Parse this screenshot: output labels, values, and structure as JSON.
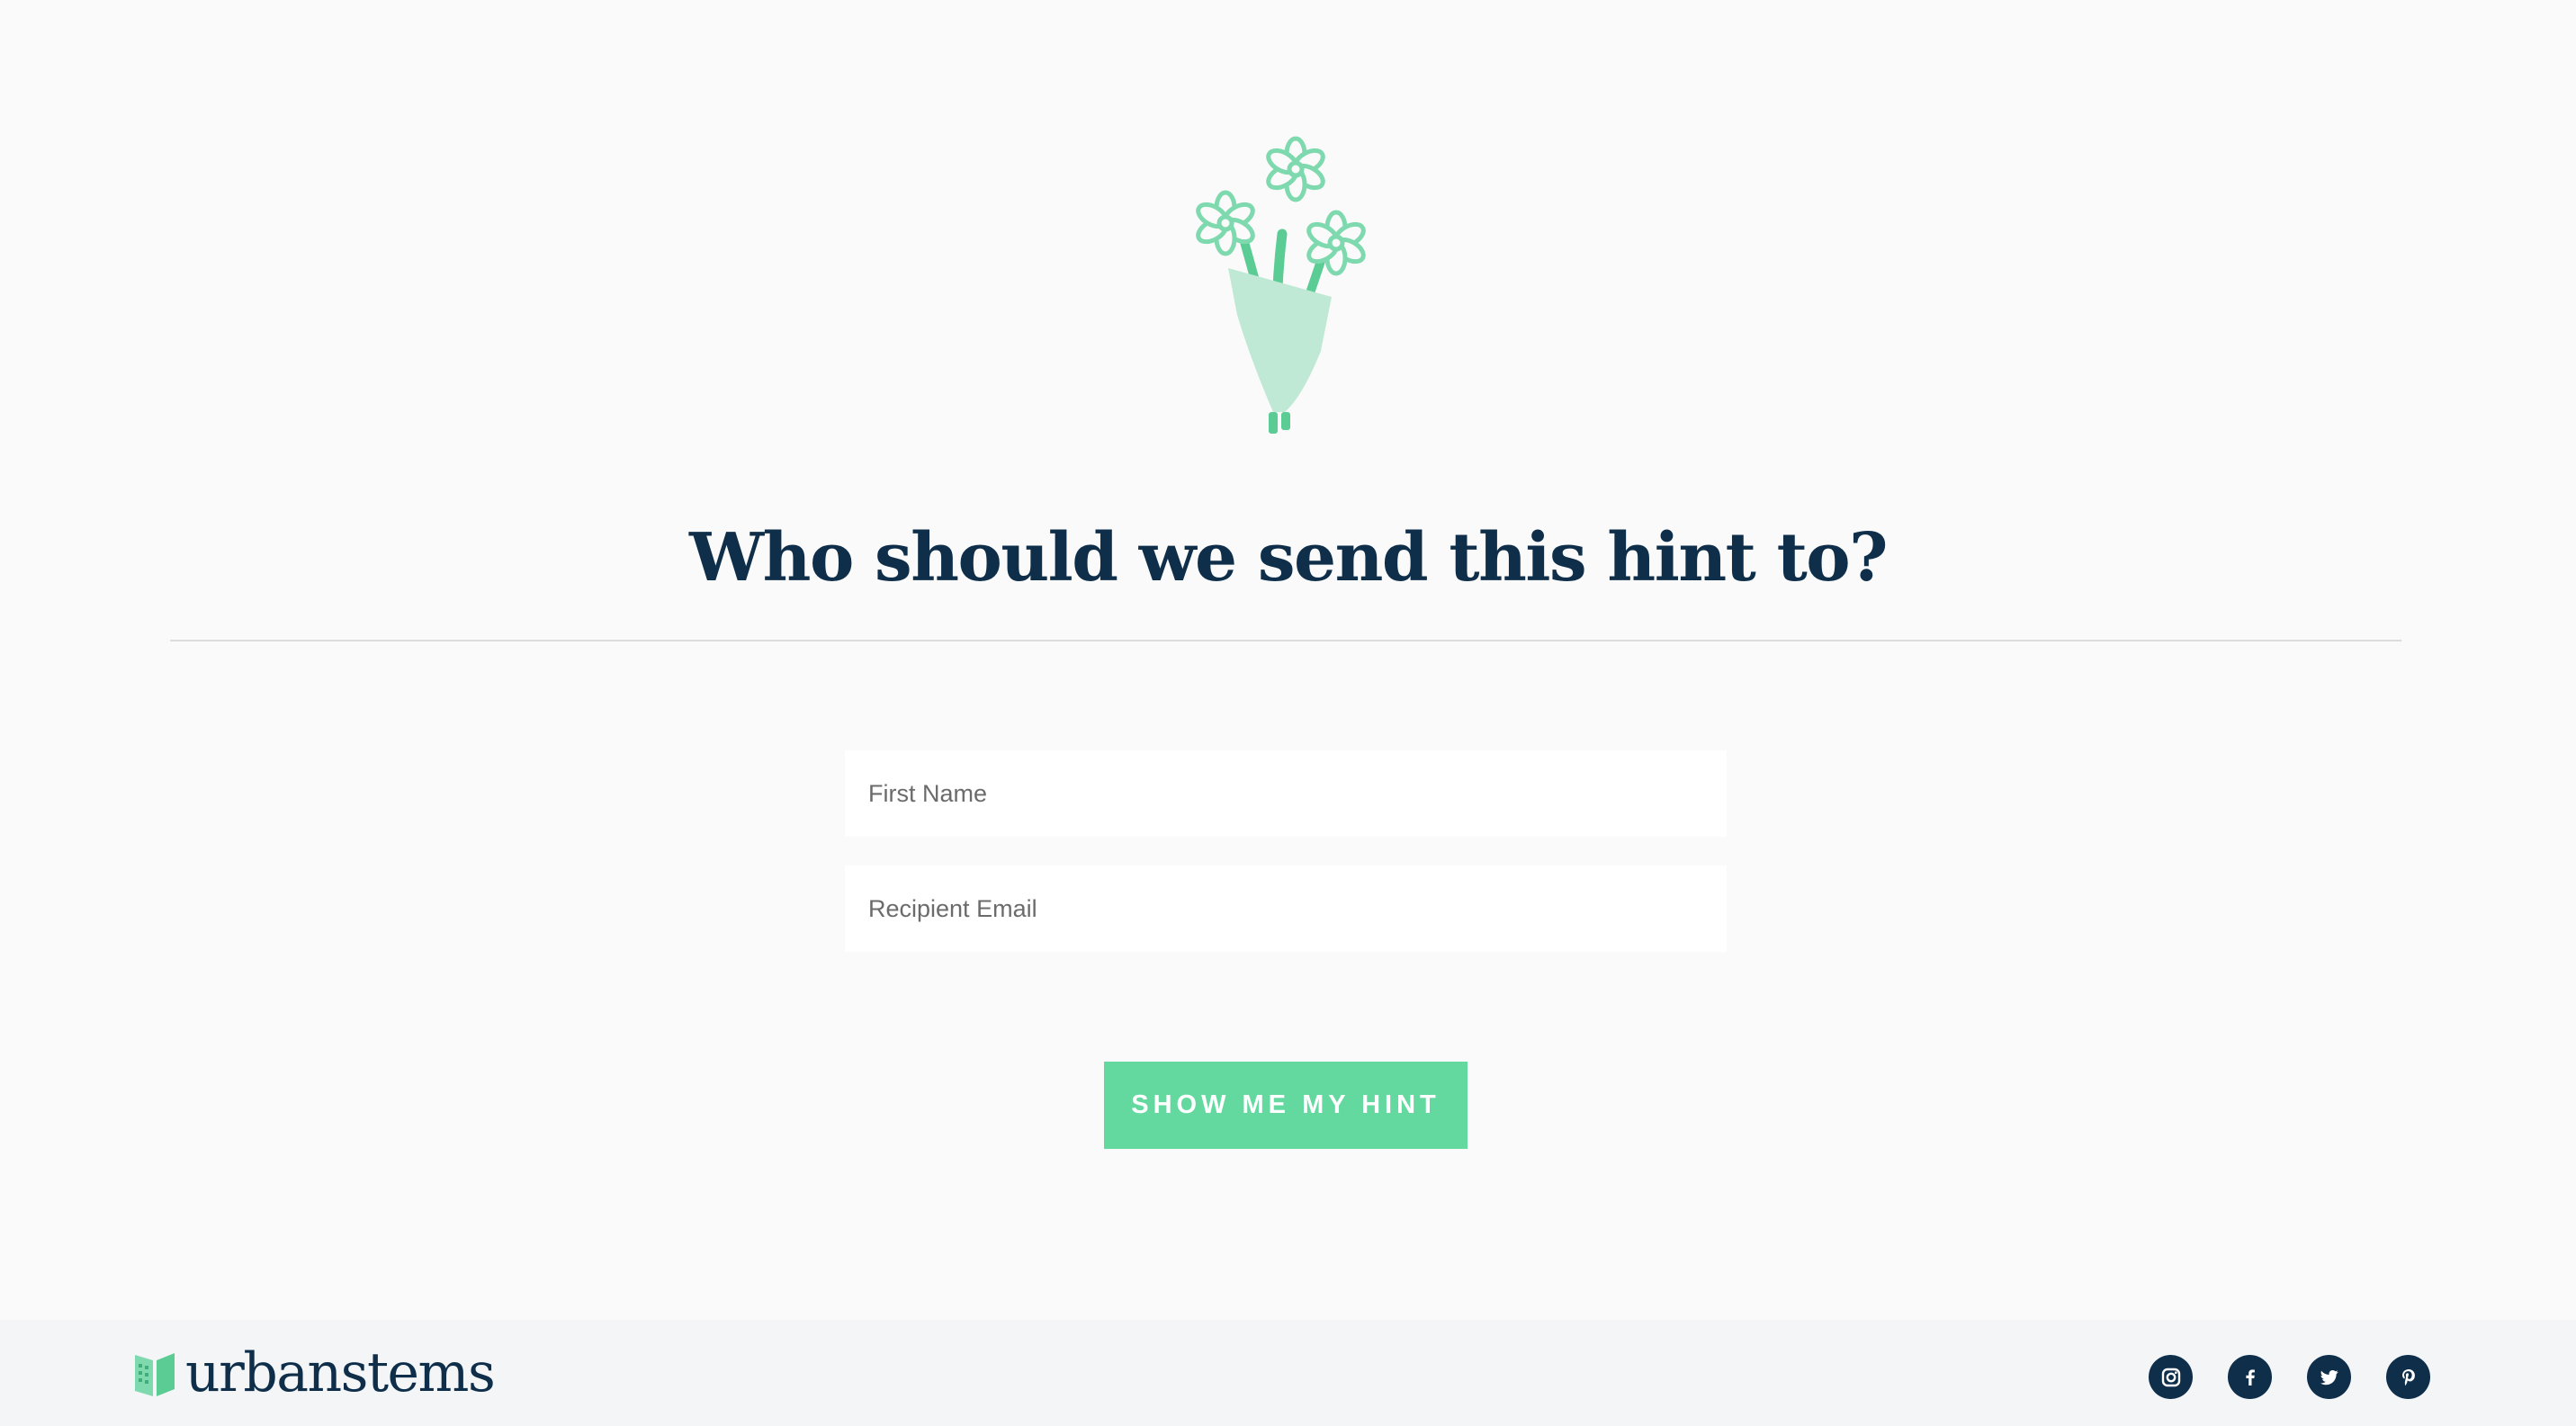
{
  "hero": {
    "illustration": "flower-bouquet-illustration",
    "headline": "Who should we send this hint to?"
  },
  "form": {
    "first_name_placeholder": "First Name",
    "first_name_value": "",
    "email_placeholder": "Recipient Email",
    "email_value": "",
    "submit_label": "SHOW ME MY HINT"
  },
  "footer": {
    "brand_name": "urbanstems",
    "social_icons": [
      "instagram-icon",
      "facebook-icon",
      "twitter-icon",
      "pinterest-icon"
    ]
  },
  "colors": {
    "background": "#fafafa",
    "heading": "#0e2e4a",
    "accent": "#63d9a0",
    "footer_background": "#f3f5f7",
    "divider": "#dcdcdc"
  }
}
